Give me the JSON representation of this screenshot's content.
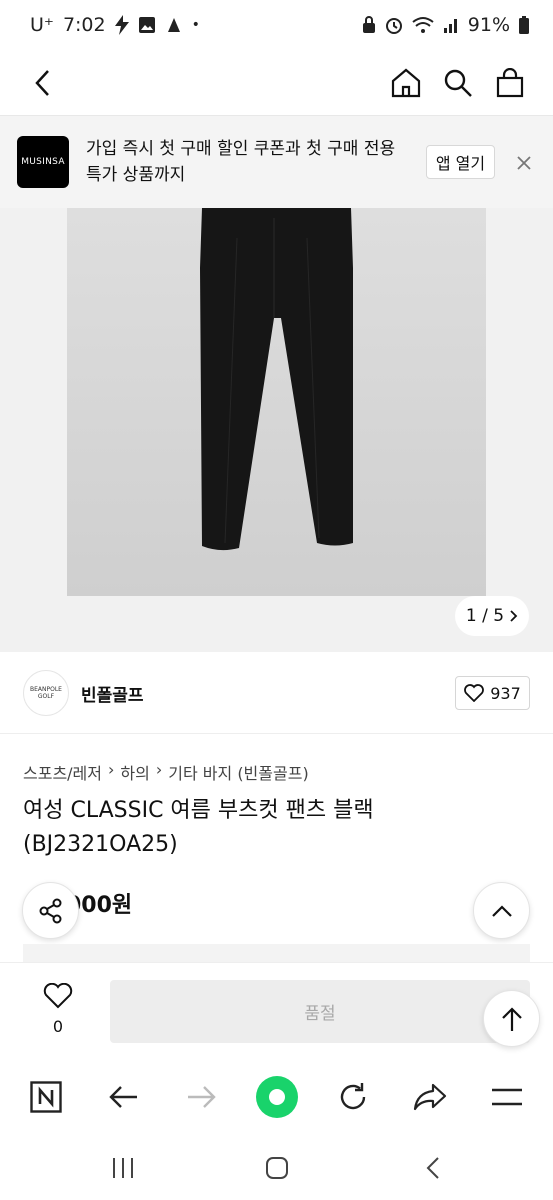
{
  "status_bar": {
    "carrier": "U⁺",
    "time": "7:02",
    "battery": "91%"
  },
  "banner": {
    "logo_text": "MUSINSA",
    "message": "가입 즉시 첫 구매 할인 쿠폰과 첫 구매 전용 특가 상품까지",
    "open_app_label": "앱 열기"
  },
  "gallery": {
    "pager": "1 / 5"
  },
  "brand": {
    "logo_text": "BEANPOLE GOLF",
    "name": "빈폴골프",
    "like_count": "937"
  },
  "breadcrumb": [
    "스포츠/레저",
    "하의",
    "기타 바지 (빈폴골프)"
  ],
  "product": {
    "title": "여성 CLASSIC 여름 부츠컷 팬츠 블랙 (BJ2321OA25)",
    "price": "000원"
  },
  "buy_bar": {
    "wish_count": "0",
    "soldout_label": "품절"
  },
  "icons": {
    "header": [
      "back-arrow-icon",
      "home-icon",
      "search-icon",
      "shopping-bag-icon"
    ],
    "browser": [
      "naver-n-icon",
      "back-icon",
      "forward-icon",
      "green-home-icon",
      "refresh-icon",
      "share-icon",
      "menu-icon"
    ]
  },
  "colors": {
    "accent_green": "#19d36b",
    "soldout_bg": "#ededed",
    "soldout_text": "#a8a8a8"
  }
}
